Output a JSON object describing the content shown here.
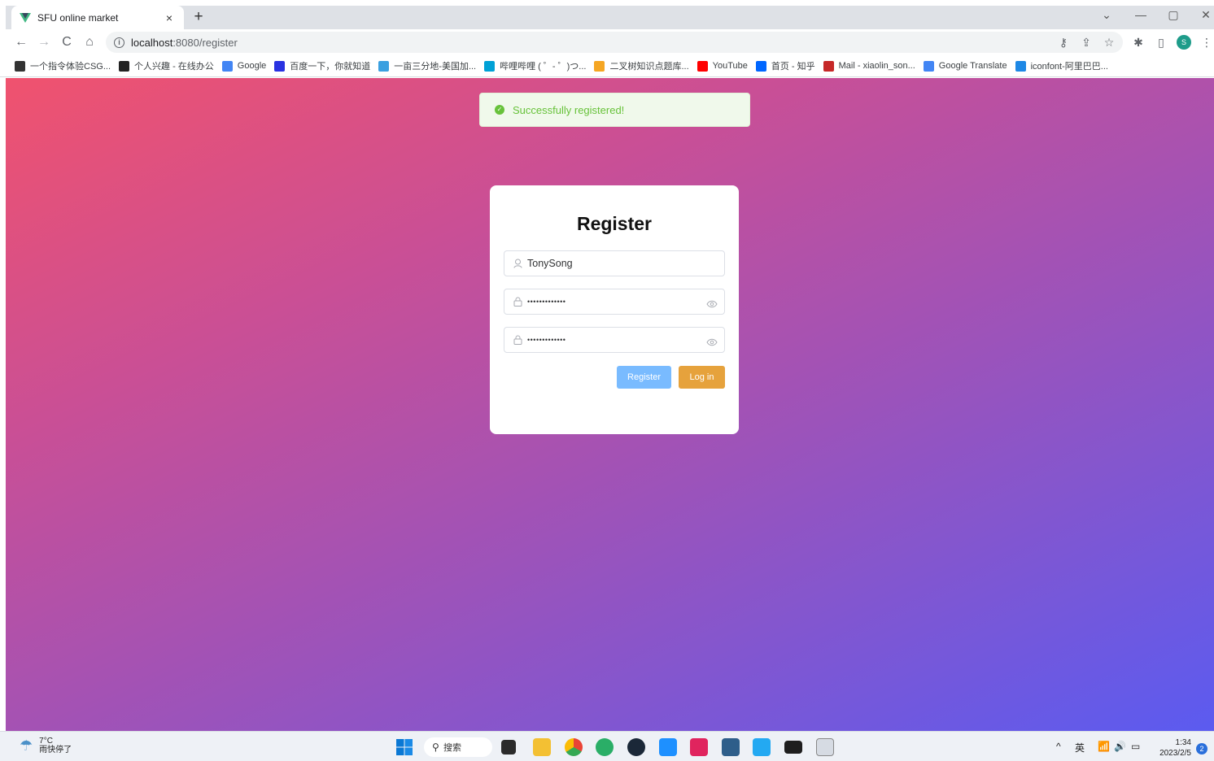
{
  "browser": {
    "tab_title": "SFU online market",
    "tab_close": "×",
    "new_tab": "+",
    "url_host": "localhost",
    "url_path": ":8080/register",
    "profile_initial": "S",
    "bookmarks": [
      {
        "label": "一个指令体验CSG...",
        "icon": "terminal-icon",
        "color": "#333333"
      },
      {
        "label": "个人兴趣 - 在线办公",
        "icon": "circle-play-icon",
        "color": "#222222"
      },
      {
        "label": "Google",
        "icon": "google-icon",
        "color": "#4285f4"
      },
      {
        "label": "百度一下，你就知道",
        "icon": "baidu-icon",
        "color": "#2932e1"
      },
      {
        "label": "一亩三分地-美国加...",
        "icon": "leaf-icon",
        "color": "#3aa0e0"
      },
      {
        "label": "哔哩哔哩 ( ゜- ゜)つ...",
        "icon": "bilibili-icon",
        "color": "#00a1d6"
      },
      {
        "label": "二叉树知识点题库...",
        "icon": "c-icon",
        "color": "#f5a623"
      },
      {
        "label": "YouTube",
        "icon": "youtube-icon",
        "color": "#ff0000"
      },
      {
        "label": "首页 - 知乎",
        "icon": "zhihu-icon",
        "color": "#0066ff"
      },
      {
        "label": "Mail - xiaolin_son...",
        "icon": "mail-icon",
        "color": "#c62828"
      },
      {
        "label": "Google Translate",
        "icon": "translate-icon",
        "color": "#4285f4"
      },
      {
        "label": "iconfont-阿里巴巴...",
        "icon": "iconfont-icon",
        "color": "#1e88e5"
      }
    ]
  },
  "page": {
    "toast": {
      "text": "Successfully registered!",
      "color": "#67c23a"
    },
    "form": {
      "title": "Register",
      "username_value": "TonySong",
      "password_mask": "•••••••••••••",
      "confirm_mask": "•••••••••••••",
      "register_label": "Register",
      "login_label": "Log in"
    }
  },
  "taskbar": {
    "weather_temp": "7°C",
    "weather_desc": "雨快停了",
    "search_label": "搜索",
    "ime": "英",
    "tray_up": "^",
    "time": "1:34",
    "date": "2023/2/5",
    "notifications": "2"
  }
}
